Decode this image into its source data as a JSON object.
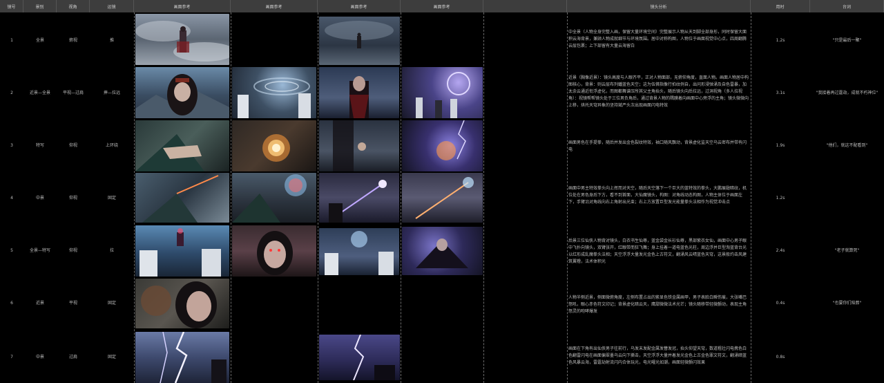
{
  "headers": [
    "镜号",
    "景别",
    "视角",
    "运镜",
    "画面参考",
    "画面参考",
    "画面参考",
    "画面参考",
    "",
    "镜头分析",
    "",
    "用时",
    "台词"
  ],
  "rows": [
    {
      "no": "1",
      "shot": "全景",
      "angle": "俯视",
      "move": "推",
      "analysis": "中全景（人物全身完整入画，保留大量环境空间）完整展示人物从天到脚全部身形，同时保留大面积云海背景，兼顾人物成就细节与环境氛围。居中对称构图，人物位于画面视觉中心点，四周翻腾云层包裹；上下部留有大量云海留白",
      "duration": "1.2s",
      "line": "\"只是最后一聚\""
    },
    {
      "no": "2",
      "shot": "近景—全景",
      "angle": "平视—过肩",
      "move": "摔—拉远",
      "analysis": "近景（胸像近景）：镜头高度与人眼齐平，正对人物面部，无俯仰角度，直面人物。画面人物居中构图核心，背景：则云层布列蟠蓝色天空；这为伍佛指像行拍纹例自，出问形浸弹涌及自色雷暴，加太余云通近衔浮虚化，而图都舞谱压所其父主角抬头，随后镜头向后拉远，过洞视角（多人拉视角）：视镜帮帮镜头处于三位男负角后，通过背景人物的隅膜着向画面中心旁浮的主角；镜头微微向上移，烘托天穹异象的坚持斌严头次出现画面闪电特效",
      "duration": "3.1s",
      "line": "\"我接着再过霆劫，成就不朽神位\""
    },
    {
      "no": "3",
      "shot": "特写",
      "angle": "仰视",
      "move": "上环绕",
      "analysis": "画面男色在手提拳，随后并发出金色裂纹特效，袖口随风飘动，背景虚化监天空乌云密布并带有闪电",
      "duration": "1.9s",
      "line": "\"他们，就这不配看到\""
    },
    {
      "no": "4",
      "shot": "中景",
      "angle": "仰视",
      "move": "固定",
      "analysis": "画面中男主特效拳头向上挥而对天空，随后天空落下一个巨大的蓝特效的拳头，大鹏展翅暗纹，机位处在男色身后下方，看不到首面，大仙魔镜头，构图：对角线动态构图，人物主体位于画面左下，手臂沿对角线向右上角射出光束；右上方放置巨型发光能量拳头法相作为视觉冲击点",
      "duration": "1.2s",
      "line": ""
    },
    {
      "no": "5",
      "shot": "全景—特写",
      "angle": "仰视",
      "move": "拉",
      "analysis": "后景三位仙侠人物背对镜头，白衣书生仙尊，蓝金袋金长衫仙尊，黑部紫衣女仙，画面中心男子眼中飞扑向镜头，双臂张开，红眼带而狂飞舞；身上挂着一道电蓝色光柱，周边浮并巨型淘蓝背台光以红形成乱魔拳头法相；天空浮浮大量发光金色上古符文，翻涌风云晴蓝色天穹，这景般灼击风建筑翼橹，法术体积光",
      "duration": "2.4s",
      "line": "\"老子就算死\""
    },
    {
      "no": "6",
      "shot": "近景",
      "angle": "平视",
      "move": "固定",
      "analysis": "人物半侧近景，侧面微俯角度，左侧布置占出的紫显色铁金属画甲，男子表脸白瞬伤痕，大张嘴巴怒吼，眼心赤色符文印记；背景虚化暗云天，鹰甜微微法术光芒；镜头随移带轻微颤动，表现主角怒灵的咆哮爆发",
      "duration": "0.4s",
      "line": "\"也要你们陪葬\""
    },
    {
      "no": "7",
      "shot": "中景",
      "angle": "过肩",
      "move": "固定",
      "analysis": "画面在下角有出仙侠男子往前行，乌发末发配金属发簪发冠，抬头仰望天穹，数道粗壮闪电携色白色翻雷闪电在画面偏翠墨乌云向下撕击，天空浮浮大量并着发光金色上古金色罪文符文，翻涌暗蓝色风暴云海，雷霆劫射流闪内合体玩光，电光曜光如潮，画面轻微颤闪效果",
      "duration": "0.8s",
      "line": ""
    }
  ]
}
